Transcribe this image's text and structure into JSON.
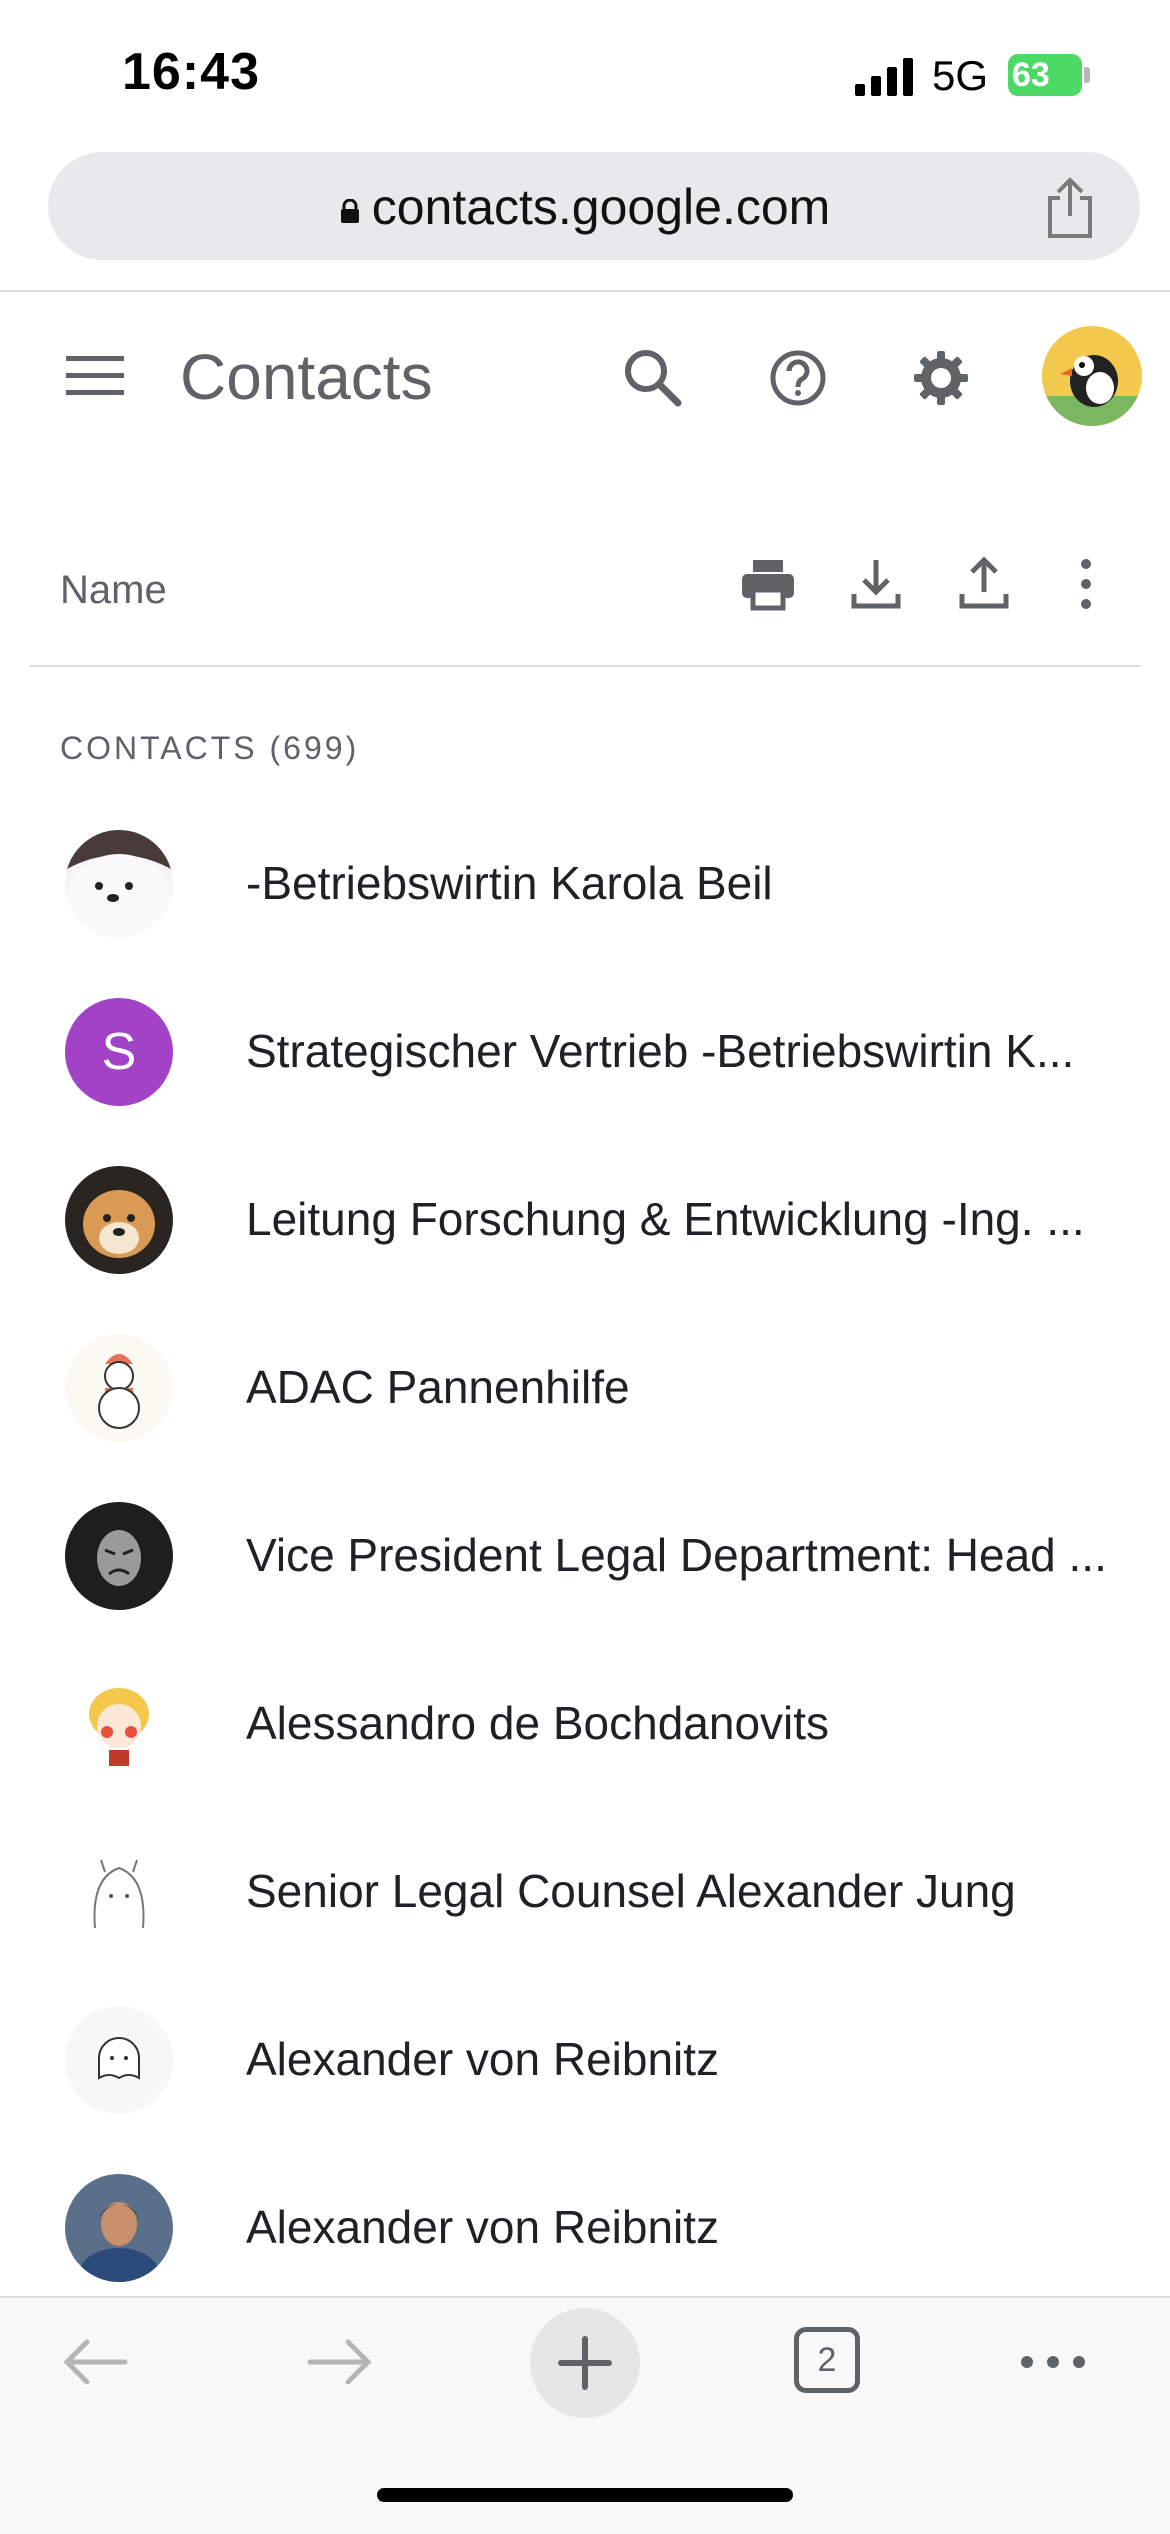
{
  "status_bar": {
    "time": "16:43",
    "network": "5G",
    "battery": "63"
  },
  "browser": {
    "url": "contacts.google.com",
    "tab_count": "2"
  },
  "app": {
    "title": "Contacts"
  },
  "toolbar": {
    "name_column": "Name"
  },
  "contacts": {
    "section_label": "CONTACTS (699)",
    "items": [
      {
        "name": "-Betriebswirtin Karola Beil",
        "avatar": "polar-bear-avatar"
      },
      {
        "name": "Strategischer Vertrieb -Betriebswirtin K...",
        "avatar": "letter-avatar",
        "initial": "S",
        "color": "#a142c7"
      },
      {
        "name": "Leitung Forschung & Entwicklung -Ing. ...",
        "avatar": "shiba-dog-avatar"
      },
      {
        "name": "ADAC Pannenhilfe",
        "avatar": "snowman-avatar"
      },
      {
        "name": "Vice President Legal Department: Head ...",
        "avatar": "hooded-face-avatar"
      },
      {
        "name": "Alessandro de Bochdanovits",
        "avatar": "cartoon-girl-avatar"
      },
      {
        "name": "Senior Legal Counsel Alexander Jung",
        "avatar": "sketch-avatar"
      },
      {
        "name": "Alexander von Reibnitz",
        "avatar": "ghost-avatar"
      },
      {
        "name": "Alexander von Reibnitz",
        "avatar": "person-photo-avatar"
      }
    ]
  },
  "colors": {
    "text_primary": "#202124",
    "text_secondary": "#5f6368",
    "accent_purple": "#a142c7",
    "battery_green": "#4cd964"
  }
}
